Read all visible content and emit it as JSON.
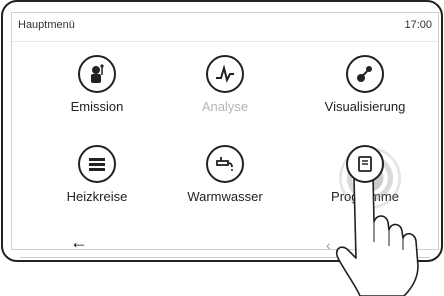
{
  "header": {
    "title": "Hauptmenü",
    "time": "17:00"
  },
  "tiles": [
    {
      "label": "Emission",
      "icon": "chimney-sweep-icon",
      "enabled": true
    },
    {
      "label": "Analyse",
      "icon": "analysis-graph-icon",
      "enabled": false
    },
    {
      "label": "Visualisierung",
      "icon": "visualization-icon",
      "enabled": true
    },
    {
      "label": "Heizkreise",
      "icon": "heating-circuits-icon",
      "enabled": true
    },
    {
      "label": "Warmwasser",
      "icon": "hot-water-tap-icon",
      "enabled": true
    },
    {
      "label": "Programme",
      "icon": "programs-icon",
      "enabled": true
    }
  ],
  "nav": {
    "back_icon": "back-arrow-icon",
    "prev_icon": "chevron-left-icon"
  }
}
